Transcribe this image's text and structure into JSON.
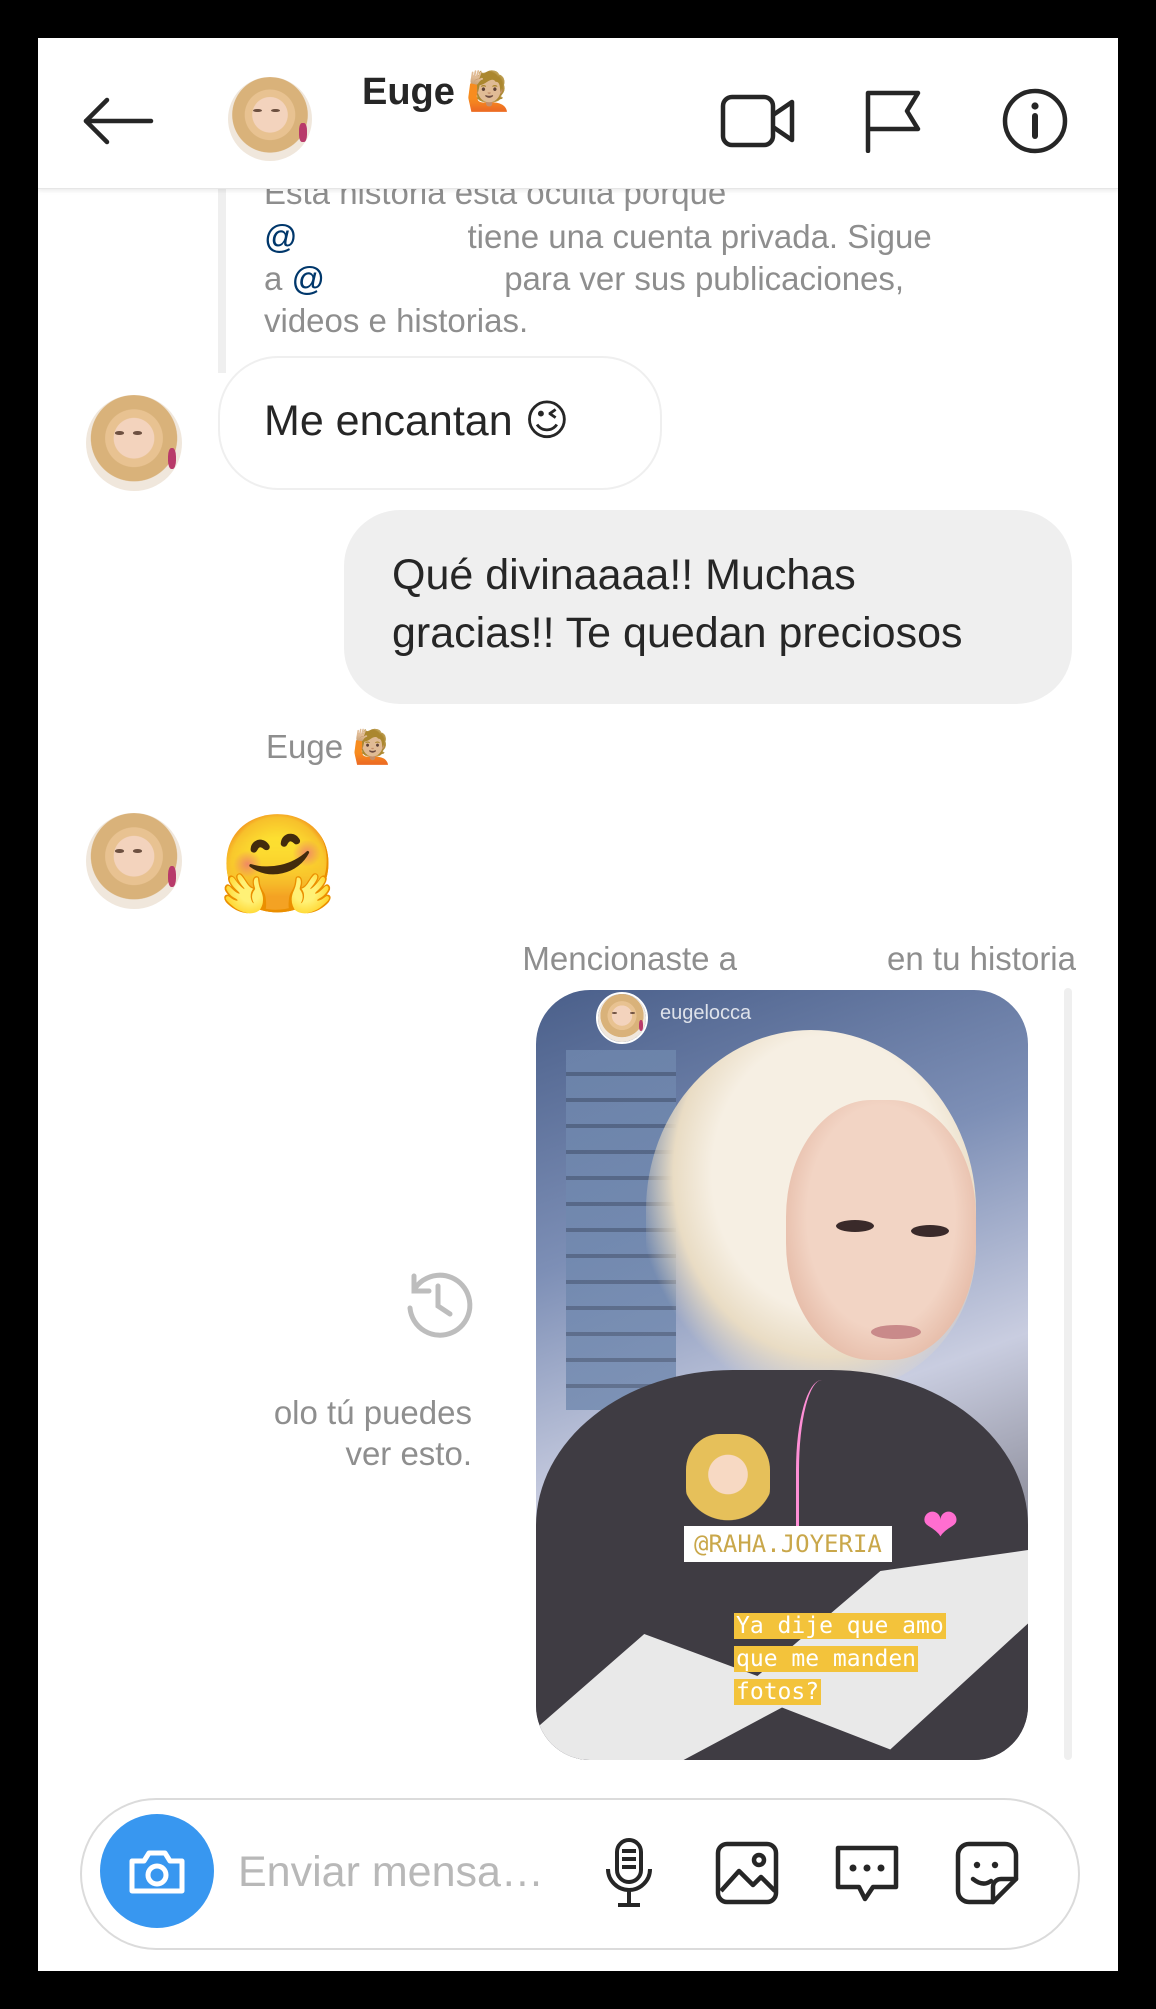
{
  "header": {
    "contact_name": "Euge 🙋🏼",
    "icons": [
      "back-arrow-icon",
      "video-camera-icon",
      "flag-icon",
      "info-icon"
    ]
  },
  "hidden_story": {
    "line1": "Esta historia está oculta porque",
    "line2_prefix": "@",
    "line2_suffix": "tiene una cuenta privada. Sigue",
    "line3_prefix": "a ",
    "line3_mention": "@",
    "line3_suffix": " para ver sus publicaciones,",
    "line4": "videos e historias."
  },
  "messages": {
    "incoming_1": "Me encantan 😉",
    "outgoing_1_line1": "Qué divinaaaa!! Muchas",
    "outgoing_1_line2": "gracias!! Te quedan preciosos",
    "sender_label": "Euge 🙋🏼",
    "incoming_2": "🤗"
  },
  "story_mention": {
    "note_prefix": "Mencionaste a",
    "note_suffix": "en tu historia",
    "story_username": "eugelocca",
    "tag_sticker": "@RAHA.JOYERIA",
    "caption": "Ya dije que amo que me manden fotos?",
    "heart": "❤",
    "only_you_line1": "olo tú puedes",
    "only_you_line2": "ver esto."
  },
  "composer": {
    "placeholder": "Enviar mensa…",
    "icons": [
      "camera-icon",
      "microphone-icon",
      "gallery-icon",
      "message-dots-icon",
      "sticker-icon"
    ]
  },
  "colors": {
    "accent": "#3897f0",
    "bubble_out": "#efefef",
    "secondary_text": "#8e8e8e",
    "mention": "#00376b",
    "caption_highlight": "#f3c33b"
  }
}
